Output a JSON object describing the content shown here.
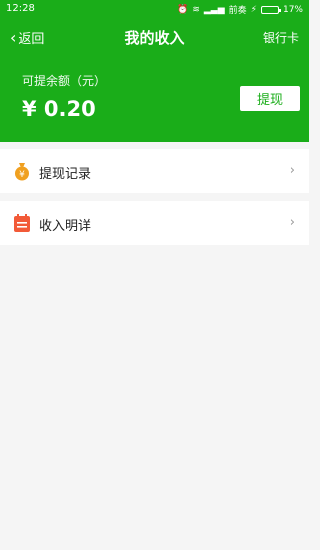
{
  "status": {
    "time": "12:28",
    "carrier": "前奏",
    "battery": "17%"
  },
  "nav": {
    "back": "返回",
    "title": "我的收入",
    "right": "银行卡"
  },
  "balance": {
    "label": "可提余额（元）",
    "value": "¥ 0.20",
    "button": "提现"
  },
  "menu": [
    {
      "label": "提现记录",
      "icon": "money-bag-icon"
    },
    {
      "label": "收入明详",
      "icon": "calendar-icon"
    }
  ],
  "colors": {
    "brand": "#1aad19",
    "bg": "#f5f5f5",
    "icon_orange": "#f0a020",
    "icon_red": "#f25a38"
  }
}
